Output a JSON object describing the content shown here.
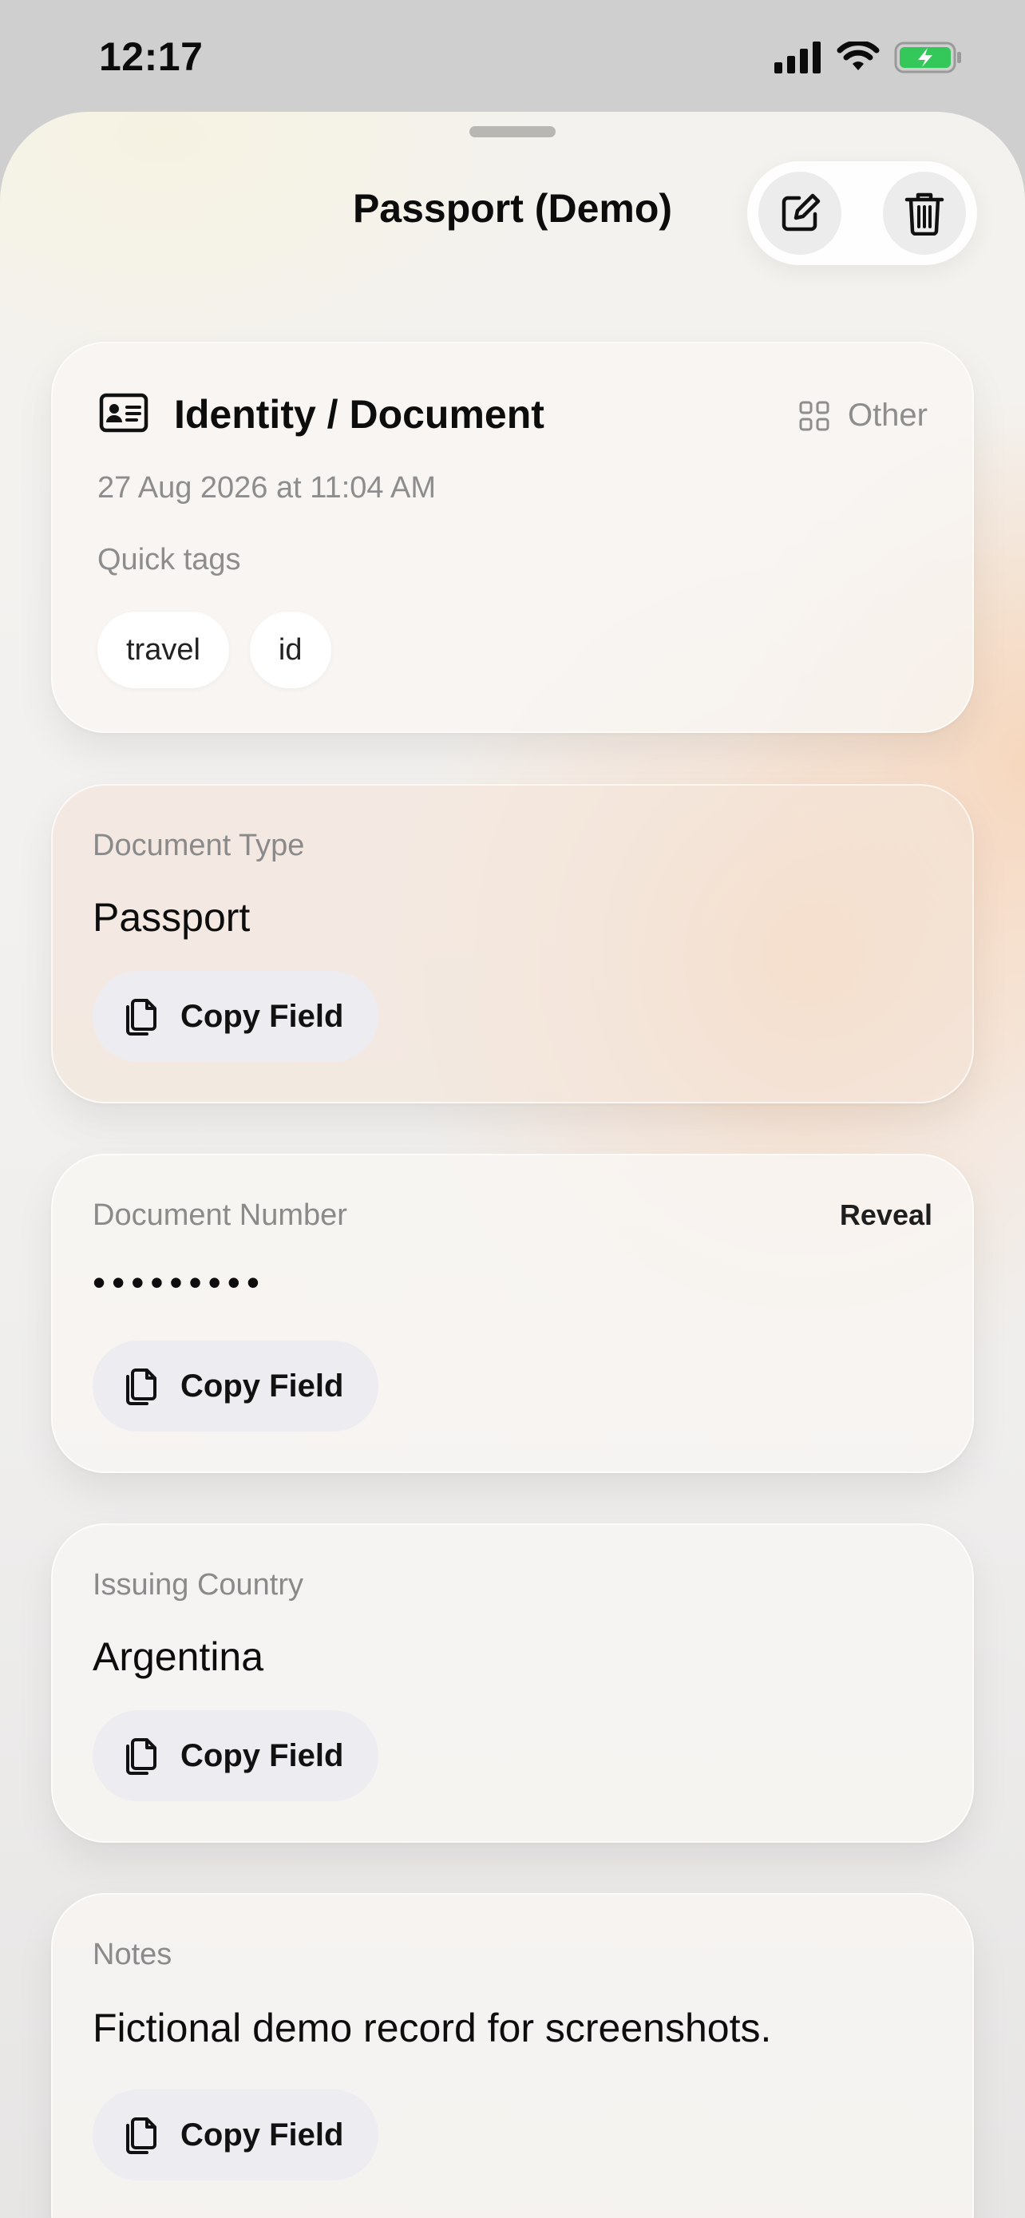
{
  "status_bar": {
    "time": "12:17"
  },
  "sheet": {
    "title": "Passport (Demo)"
  },
  "header_card": {
    "title": "Identity / Document",
    "category": "Other",
    "date": "27 Aug 2026 at 11:04 AM",
    "quick_tags_label": "Quick tags",
    "tags": [
      "travel",
      "id"
    ]
  },
  "fields": [
    {
      "label": "Document Type",
      "value": "Passport",
      "copy_label": "Copy Field"
    },
    {
      "label": "Document Number",
      "value": "•••••••••",
      "reveal_label": "Reveal",
      "copy_label": "Copy Field"
    },
    {
      "label": "Issuing Country",
      "value": "Argentina",
      "copy_label": "Copy Field"
    },
    {
      "label": "Notes",
      "value": "Fictional demo record for screenshots.",
      "copy_label": "Copy Field"
    }
  ],
  "colors": {
    "battery_fill": "#34c759",
    "accent_text": "#111111",
    "secondary_text": "#8d8d8d"
  }
}
